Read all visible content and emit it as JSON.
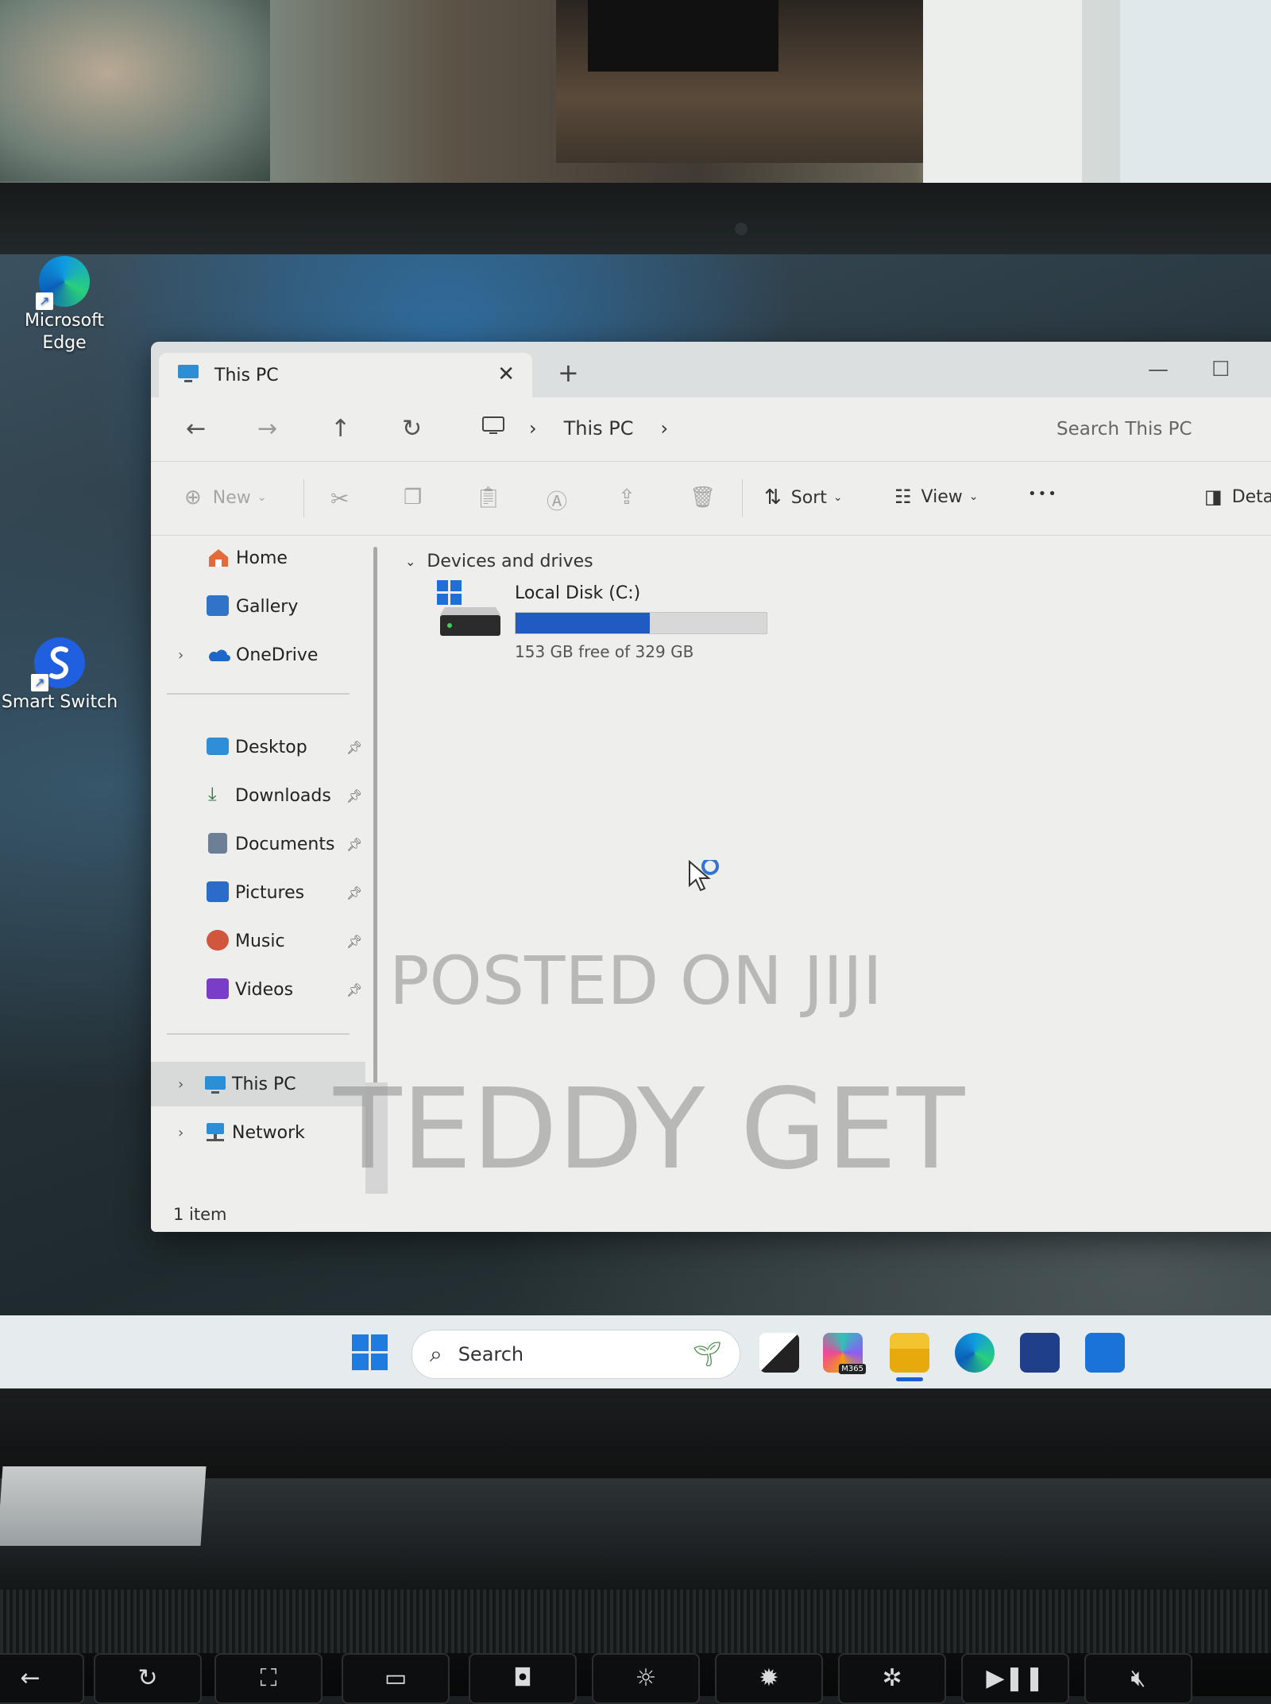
{
  "desktop": {
    "icons": [
      {
        "label": "Microsoft\nEdge",
        "icon": "edge-icon"
      },
      {
        "label": "Smart Switch",
        "icon": "smart-switch-icon"
      }
    ]
  },
  "window": {
    "tab_title": "This PC",
    "new_tab_glyph": "+",
    "close_glyph": "✕",
    "address": {
      "segments": [
        "This PC"
      ]
    },
    "search_placeholder": "Search This PC",
    "toolbar": {
      "new_label": "New",
      "sort_label": "Sort",
      "view_label": "View",
      "more_glyph": "•••",
      "details_label": "Deta"
    },
    "sidebar": {
      "quick": [
        {
          "label": "Home",
          "icon": "home-icon"
        },
        {
          "label": "Gallery",
          "icon": "gallery-icon"
        },
        {
          "label": "OneDrive",
          "icon": "onedrive-icon"
        }
      ],
      "pinned": [
        {
          "label": "Desktop",
          "icon": "desktop-folder-icon"
        },
        {
          "label": "Downloads",
          "icon": "downloads-icon"
        },
        {
          "label": "Documents",
          "icon": "documents-icon"
        },
        {
          "label": "Pictures",
          "icon": "pictures-icon"
        },
        {
          "label": "Music",
          "icon": "music-icon"
        },
        {
          "label": "Videos",
          "icon": "videos-icon"
        }
      ],
      "locations": [
        {
          "label": "This PC",
          "icon": "computer-icon",
          "selected": true
        },
        {
          "label": "Network",
          "icon": "network-icon",
          "selected": false
        }
      ]
    },
    "content": {
      "group_header": "Devices and drives",
      "drives": [
        {
          "name": "Local Disk (C:)",
          "free_text": "153 GB free of 329 GB",
          "used_fraction": 0.535
        }
      ]
    },
    "status": {
      "item_count": "1 item"
    }
  },
  "watermark": {
    "line1": "POSTED ON JIJI",
    "line2": "TEDDY GET"
  },
  "taskbar": {
    "search_label": "Search",
    "apps": [
      "start-icon",
      "task-view-icon",
      "copilot-m365-icon",
      "file-explorer-icon",
      "edge-icon",
      "store-icon",
      "outlook-icon"
    ],
    "m365_badge": "M365"
  },
  "colors": {
    "accent": "#1f5bc2",
    "window_bg": "#eeeeec",
    "titlebar_bg": "#dcdfe0"
  }
}
